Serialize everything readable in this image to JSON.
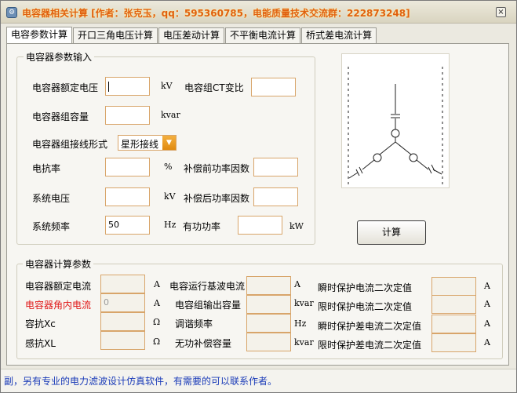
{
  "window": {
    "title": "电容器相关计算  [作者：张克玉，qq：595360785，电能质量技术交流群：222873248]",
    "close_glyph": "×",
    "icon_glyph": "⚙"
  },
  "tabs": [
    {
      "label": "电容参数计算",
      "active": true
    },
    {
      "label": "开口三角电压计算",
      "active": false
    },
    {
      "label": "电压差动计算",
      "active": false
    },
    {
      "label": "不平衡电流计算",
      "active": false
    },
    {
      "label": "桥式差电流计算",
      "active": false
    }
  ],
  "input_group": {
    "title": "电容器参数输入",
    "rated_voltage": {
      "label": "电容器额定电压",
      "value": "",
      "unit": "kV"
    },
    "ct_ratio": {
      "label": "电容组CT变比",
      "value": ""
    },
    "capacity": {
      "label": "电容器组容量",
      "value": "",
      "unit": "kvar"
    },
    "wiring": {
      "label": "电容器组接线形式",
      "selected": "星形接线"
    },
    "reactance_ratio": {
      "label": "电抗率",
      "value": "",
      "unit": "%"
    },
    "pf_before": {
      "label": "补偿前功率因数",
      "value": ""
    },
    "system_voltage": {
      "label": "系统电压",
      "value": "",
      "unit": "kV"
    },
    "pf_after": {
      "label": "补偿后功率因数",
      "value": ""
    },
    "system_frequency": {
      "label": "系统频率",
      "value": "50",
      "unit": "Hz"
    },
    "active_power": {
      "label": "有功功率",
      "value": "",
      "unit": "kW"
    }
  },
  "calc_button": "计算",
  "output_group": {
    "title": "电容器计算参数",
    "rows": [
      {
        "label": "电容器额定电流",
        "value": "",
        "unit": "A",
        "red": false
      },
      {
        "label": "电容器角内电流",
        "value": "0",
        "unit": "A",
        "red": true
      },
      {
        "label": "容抗Xc",
        "value": "",
        "unit": "Ω",
        "red": false
      },
      {
        "label": "感抗XL",
        "value": "",
        "unit": "Ω",
        "red": false
      }
    ],
    "rows_mid": [
      {
        "label": "电容运行基波电流",
        "value": "",
        "unit": "A"
      },
      {
        "label": "电容组输出容量",
        "value": "",
        "unit": "kvar"
      },
      {
        "label": "调谐频率",
        "value": "",
        "unit": "Hz"
      },
      {
        "label": "无功补偿容量",
        "value": "",
        "unit": "kvar"
      }
    ],
    "rows_right": [
      {
        "label": "瞬时保护电流二次定值",
        "value": "",
        "unit": "A"
      },
      {
        "label": "限时保护电流二次定值",
        "value": "",
        "unit": "A"
      },
      {
        "label": "瞬时保护差电流二次定值",
        "value": "",
        "unit": "A"
      },
      {
        "label": "限时保护差电流二次定值",
        "value": "",
        "unit": "A"
      }
    ]
  },
  "status": "副，另有专业的电力滤波设计仿真软件，有需要的可以联系作者。"
}
